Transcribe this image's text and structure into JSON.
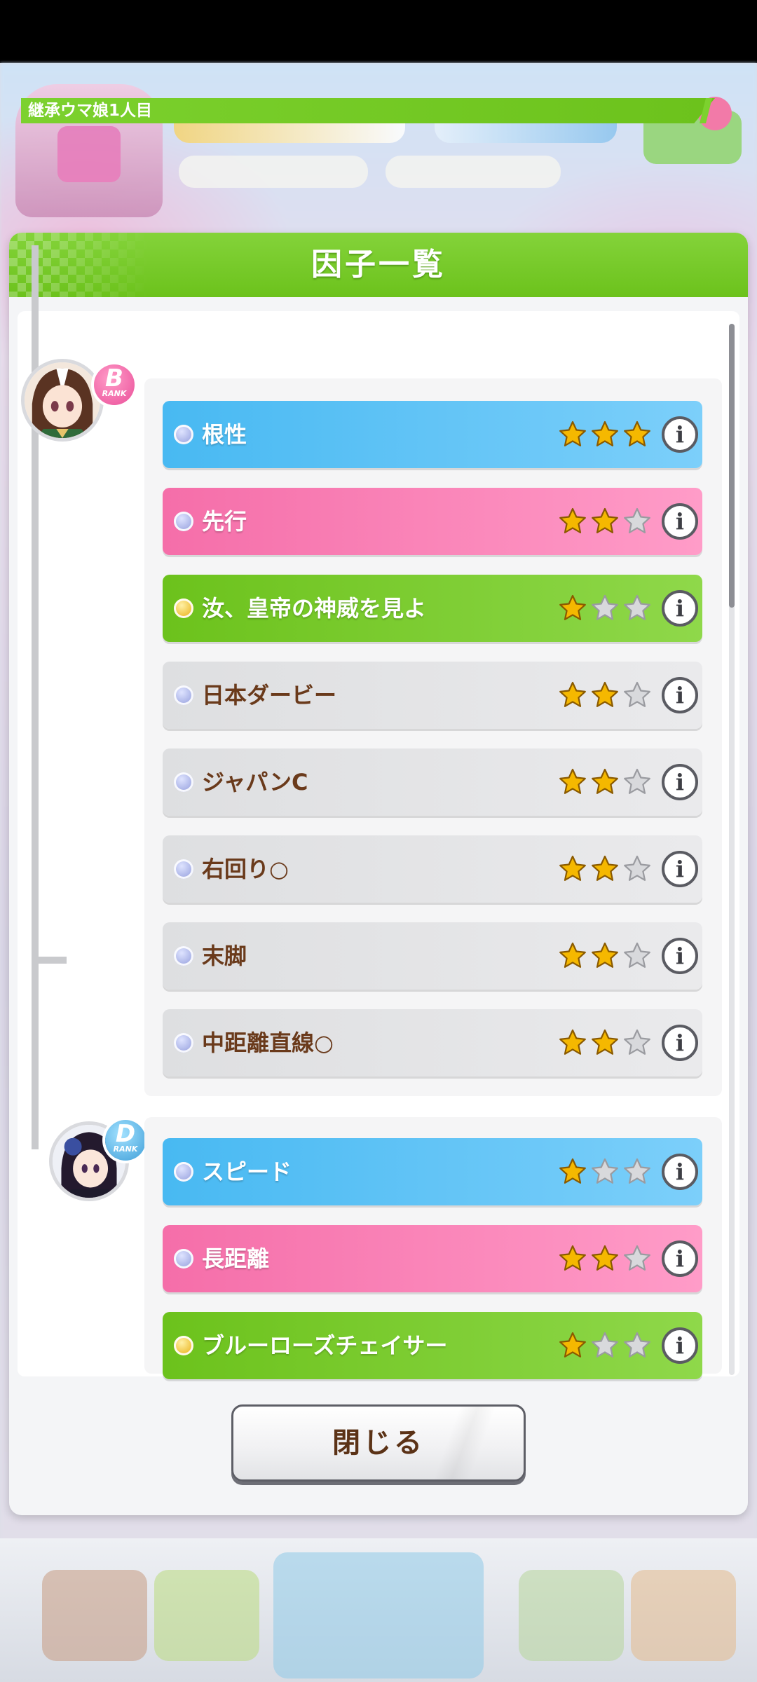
{
  "dialog": {
    "title": "因子一覧",
    "section_label": "継承ウマ娘1人目",
    "close_label": "閉じる"
  },
  "colors": {
    "header_green": "#6cc21c",
    "row_blue": "#48b9f2",
    "row_pink": "#f56ea9",
    "row_green": "#6cc21c",
    "row_gray": "#dedfe1",
    "star_gold": "#f5b800",
    "star_empty": "#d8d9dc"
  },
  "groups": [
    {
      "rank": "B",
      "rank_sub": "RANK",
      "factors": [
        {
          "name": "根性",
          "type": "blue",
          "dot": "blue",
          "stars": 3
        },
        {
          "name": "先行",
          "type": "pink",
          "dot": "blue",
          "stars": 2
        },
        {
          "name": "汝、皇帝の神威を見よ",
          "type": "green",
          "dot": "gold",
          "stars": 1
        },
        {
          "name": "日本ダービー",
          "type": "gray",
          "dot": "blue",
          "stars": 2
        },
        {
          "name": "ジャパンC",
          "type": "gray",
          "dot": "blue",
          "stars": 2
        },
        {
          "name": "右回り○",
          "type": "gray",
          "dot": "blue",
          "stars": 2
        },
        {
          "name": "末脚",
          "type": "gray",
          "dot": "blue",
          "stars": 2
        },
        {
          "name": "中距離直線○",
          "type": "gray",
          "dot": "blue",
          "stars": 2
        }
      ]
    },
    {
      "rank": "D",
      "rank_sub": "RANK",
      "factors": [
        {
          "name": "スピード",
          "type": "blue",
          "dot": "blue",
          "stars": 1
        },
        {
          "name": "長距離",
          "type": "pink",
          "dot": "blue",
          "stars": 2
        },
        {
          "name": "ブルーローズチェイサー",
          "type": "green",
          "dot": "gold",
          "stars": 1
        }
      ]
    }
  ],
  "icons": {
    "info": "i",
    "star": "star-icon",
    "factor_dot": "factor-orb-icon"
  }
}
